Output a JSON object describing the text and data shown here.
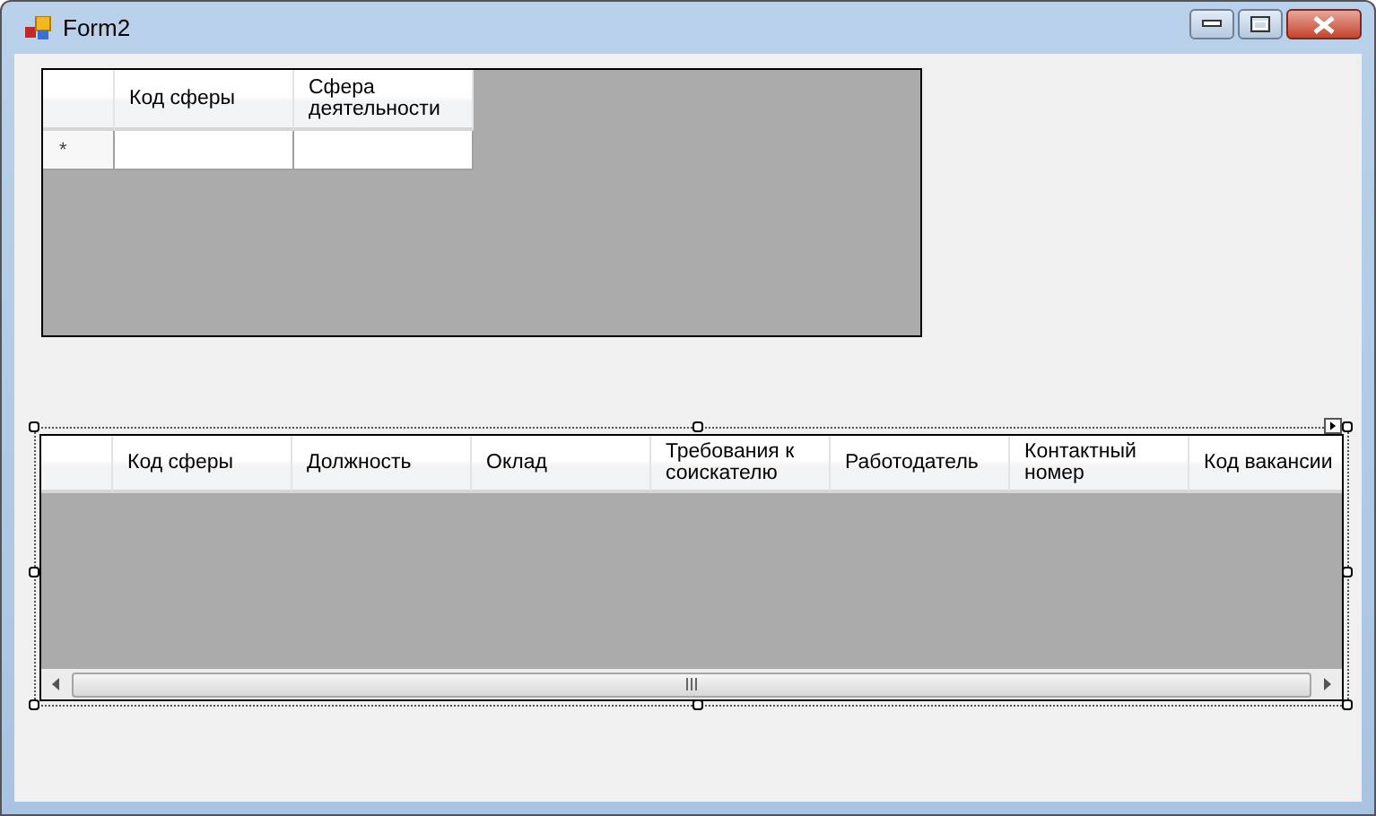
{
  "window": {
    "title": "Form2"
  },
  "grid_1": {
    "columns": [
      "Код сферы",
      "Сфера деятельности"
    ],
    "new_row_marker": "*"
  },
  "grid_2": {
    "columns": [
      "Код сферы",
      "Должность",
      "Оклад",
      "Требования к соискателю",
      "Работодатель",
      "Контактный номер",
      "Код вакансии"
    ],
    "selected_in_designer": true
  }
}
